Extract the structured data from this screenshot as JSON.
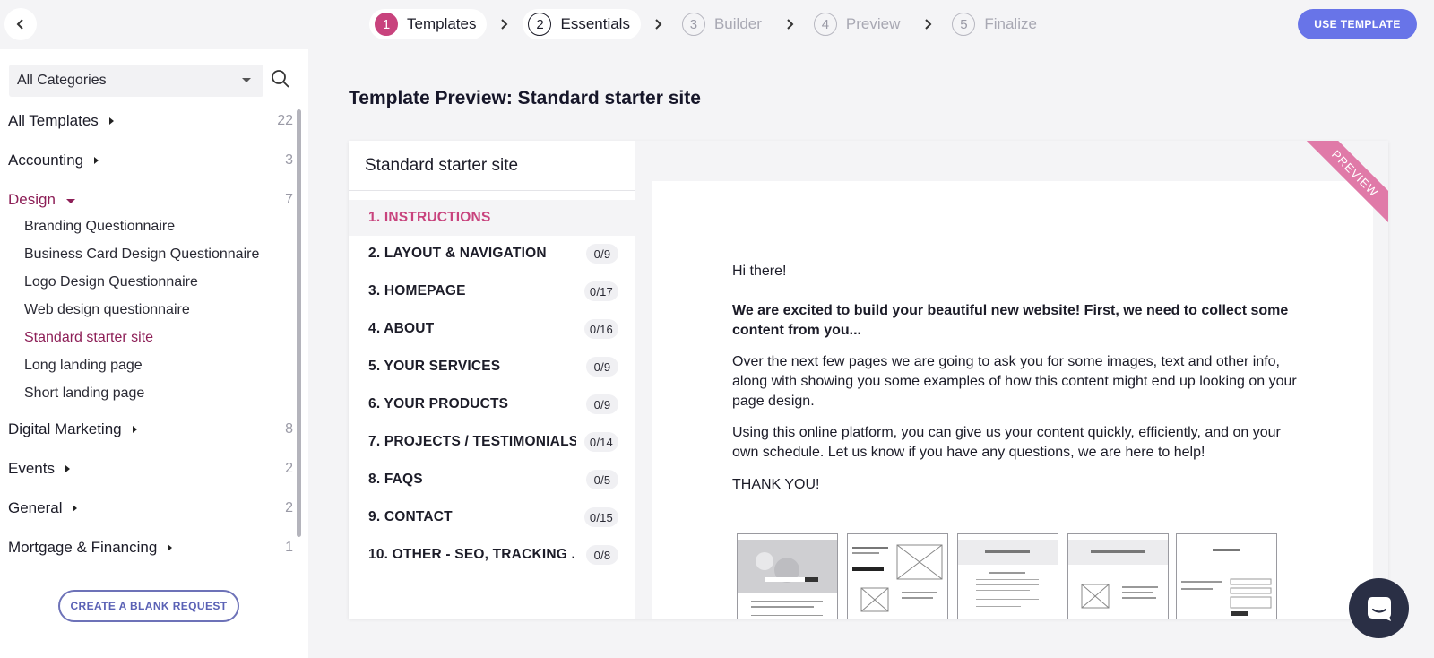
{
  "steps": [
    {
      "num": "1",
      "label": "Templates"
    },
    {
      "num": "2",
      "label": "Essentials"
    },
    {
      "num": "3",
      "label": "Builder"
    },
    {
      "num": "4",
      "label": "Preview"
    },
    {
      "num": "5",
      "label": "Finalize"
    }
  ],
  "header": {
    "use_template": "USE TEMPLATE"
  },
  "sidebar": {
    "category_select": "All Categories",
    "categories": [
      {
        "name": "All Templates",
        "count": "22"
      },
      {
        "name": "Accounting",
        "count": "3"
      },
      {
        "name": "Design",
        "count": "7"
      },
      {
        "name": "Digital Marketing",
        "count": "8"
      },
      {
        "name": "Events",
        "count": "2"
      },
      {
        "name": "General",
        "count": "2"
      },
      {
        "name": "Mortgage & Financing",
        "count": "1"
      }
    ],
    "design_items": [
      "Branding Questionnaire",
      "Business Card Design Questionnaire",
      "Logo Design Questionnaire",
      "Web design questionnaire",
      "Standard starter site",
      "Long landing page",
      "Short landing page"
    ],
    "blank_request": "CREATE A BLANK REQUEST"
  },
  "main": {
    "title": "Template Preview: Standard starter site",
    "toc_title": "Standard starter site",
    "toc": [
      {
        "label": "1. INSTRUCTIONS",
        "badge": ""
      },
      {
        "label": "2. LAYOUT & NAVIGATION",
        "badge": "0/9"
      },
      {
        "label": "3. HOMEPAGE",
        "badge": "0/17"
      },
      {
        "label": "4. ABOUT",
        "badge": "0/16"
      },
      {
        "label": "5. YOUR SERVICES",
        "badge": "0/9"
      },
      {
        "label": "6. YOUR PRODUCTS",
        "badge": "0/9"
      },
      {
        "label": "7. PROJECTS / TESTIMONIALS",
        "badge": "0/14"
      },
      {
        "label": "8. FAQS",
        "badge": "0/5"
      },
      {
        "label": "9. CONTACT",
        "badge": "0/15"
      },
      {
        "label": "10. OTHER - SEO, TRACKING ...",
        "badge": "0/8"
      }
    ],
    "ribbon": "PREVIEW",
    "preview": {
      "greeting": "Hi there!",
      "intro": "We are excited to build your beautiful new website! First, we need to collect some content from you...",
      "para1": "Over the next few pages we are going to ask you for some images, text and other info, along with showing you some examples of how this content might end up looking on your page design.",
      "para2": "Using this online platform, you can give us your content quickly, efficiently, and on your own schedule. Let us know if you have any questions, we are here to help!",
      "thanks": "THANK YOU!"
    }
  },
  "colors": {
    "accent": "#c8437d",
    "primary_button": "#6874e8",
    "selected_text": "#8d1f57"
  }
}
